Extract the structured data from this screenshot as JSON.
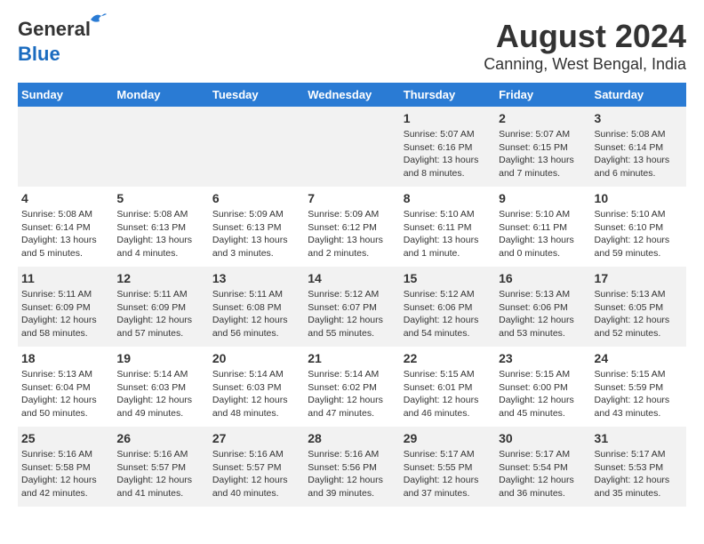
{
  "header": {
    "logo_general": "General",
    "logo_blue": "Blue",
    "title": "August 2024",
    "subtitle": "Canning, West Bengal, India"
  },
  "weekdays": [
    "Sunday",
    "Monday",
    "Tuesday",
    "Wednesday",
    "Thursday",
    "Friday",
    "Saturday"
  ],
  "weeks": [
    [
      {
        "day": "",
        "info": ""
      },
      {
        "day": "",
        "info": ""
      },
      {
        "day": "",
        "info": ""
      },
      {
        "day": "",
        "info": ""
      },
      {
        "day": "1",
        "info": "Sunrise: 5:07 AM\nSunset: 6:16 PM\nDaylight: 13 hours\nand 8 minutes."
      },
      {
        "day": "2",
        "info": "Sunrise: 5:07 AM\nSunset: 6:15 PM\nDaylight: 13 hours\nand 7 minutes."
      },
      {
        "day": "3",
        "info": "Sunrise: 5:08 AM\nSunset: 6:14 PM\nDaylight: 13 hours\nand 6 minutes."
      }
    ],
    [
      {
        "day": "4",
        "info": "Sunrise: 5:08 AM\nSunset: 6:14 PM\nDaylight: 13 hours\nand 5 minutes."
      },
      {
        "day": "5",
        "info": "Sunrise: 5:08 AM\nSunset: 6:13 PM\nDaylight: 13 hours\nand 4 minutes."
      },
      {
        "day": "6",
        "info": "Sunrise: 5:09 AM\nSunset: 6:13 PM\nDaylight: 13 hours\nand 3 minutes."
      },
      {
        "day": "7",
        "info": "Sunrise: 5:09 AM\nSunset: 6:12 PM\nDaylight: 13 hours\nand 2 minutes."
      },
      {
        "day": "8",
        "info": "Sunrise: 5:10 AM\nSunset: 6:11 PM\nDaylight: 13 hours\nand 1 minute."
      },
      {
        "day": "9",
        "info": "Sunrise: 5:10 AM\nSunset: 6:11 PM\nDaylight: 13 hours\nand 0 minutes."
      },
      {
        "day": "10",
        "info": "Sunrise: 5:10 AM\nSunset: 6:10 PM\nDaylight: 12 hours\nand 59 minutes."
      }
    ],
    [
      {
        "day": "11",
        "info": "Sunrise: 5:11 AM\nSunset: 6:09 PM\nDaylight: 12 hours\nand 58 minutes."
      },
      {
        "day": "12",
        "info": "Sunrise: 5:11 AM\nSunset: 6:09 PM\nDaylight: 12 hours\nand 57 minutes."
      },
      {
        "day": "13",
        "info": "Sunrise: 5:11 AM\nSunset: 6:08 PM\nDaylight: 12 hours\nand 56 minutes."
      },
      {
        "day": "14",
        "info": "Sunrise: 5:12 AM\nSunset: 6:07 PM\nDaylight: 12 hours\nand 55 minutes."
      },
      {
        "day": "15",
        "info": "Sunrise: 5:12 AM\nSunset: 6:06 PM\nDaylight: 12 hours\nand 54 minutes."
      },
      {
        "day": "16",
        "info": "Sunrise: 5:13 AM\nSunset: 6:06 PM\nDaylight: 12 hours\nand 53 minutes."
      },
      {
        "day": "17",
        "info": "Sunrise: 5:13 AM\nSunset: 6:05 PM\nDaylight: 12 hours\nand 52 minutes."
      }
    ],
    [
      {
        "day": "18",
        "info": "Sunrise: 5:13 AM\nSunset: 6:04 PM\nDaylight: 12 hours\nand 50 minutes."
      },
      {
        "day": "19",
        "info": "Sunrise: 5:14 AM\nSunset: 6:03 PM\nDaylight: 12 hours\nand 49 minutes."
      },
      {
        "day": "20",
        "info": "Sunrise: 5:14 AM\nSunset: 6:03 PM\nDaylight: 12 hours\nand 48 minutes."
      },
      {
        "day": "21",
        "info": "Sunrise: 5:14 AM\nSunset: 6:02 PM\nDaylight: 12 hours\nand 47 minutes."
      },
      {
        "day": "22",
        "info": "Sunrise: 5:15 AM\nSunset: 6:01 PM\nDaylight: 12 hours\nand 46 minutes."
      },
      {
        "day": "23",
        "info": "Sunrise: 5:15 AM\nSunset: 6:00 PM\nDaylight: 12 hours\nand 45 minutes."
      },
      {
        "day": "24",
        "info": "Sunrise: 5:15 AM\nSunset: 5:59 PM\nDaylight: 12 hours\nand 43 minutes."
      }
    ],
    [
      {
        "day": "25",
        "info": "Sunrise: 5:16 AM\nSunset: 5:58 PM\nDaylight: 12 hours\nand 42 minutes."
      },
      {
        "day": "26",
        "info": "Sunrise: 5:16 AM\nSunset: 5:57 PM\nDaylight: 12 hours\nand 41 minutes."
      },
      {
        "day": "27",
        "info": "Sunrise: 5:16 AM\nSunset: 5:57 PM\nDaylight: 12 hours\nand 40 minutes."
      },
      {
        "day": "28",
        "info": "Sunrise: 5:16 AM\nSunset: 5:56 PM\nDaylight: 12 hours\nand 39 minutes."
      },
      {
        "day": "29",
        "info": "Sunrise: 5:17 AM\nSunset: 5:55 PM\nDaylight: 12 hours\nand 37 minutes."
      },
      {
        "day": "30",
        "info": "Sunrise: 5:17 AM\nSunset: 5:54 PM\nDaylight: 12 hours\nand 36 minutes."
      },
      {
        "day": "31",
        "info": "Sunrise: 5:17 AM\nSunset: 5:53 PM\nDaylight: 12 hours\nand 35 minutes."
      }
    ]
  ]
}
